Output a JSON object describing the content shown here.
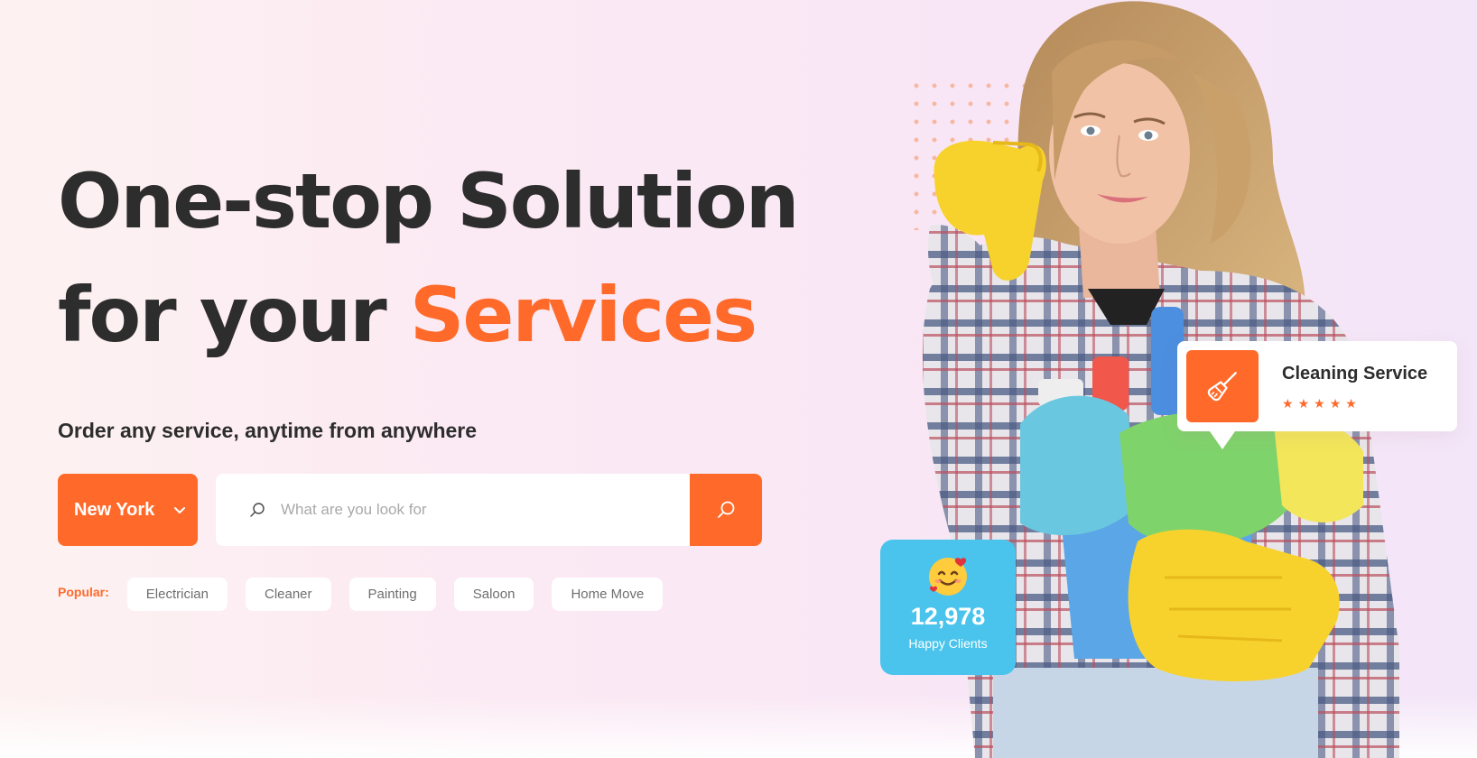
{
  "hero": {
    "headline_line1": "One-stop Solution",
    "headline_line2_prefix": "for your ",
    "headline_line2_accent": "Services",
    "subtitle": "Order any service, anytime from anywhere"
  },
  "search": {
    "city": "New York",
    "placeholder": "What are you look for",
    "value": ""
  },
  "popular": {
    "label": "Popular:",
    "tags": [
      "Electrician",
      "Cleaner",
      "Painting",
      "Saloon",
      "Home Move"
    ]
  },
  "stats_card": {
    "number": "12,978",
    "label": "Happy Clients",
    "icon": "smiling-face-with-hearts-icon"
  },
  "service_card": {
    "title": "Cleaning Service",
    "rating": 5,
    "icon": "broom-icon"
  },
  "colors": {
    "accent": "#ff6a2a",
    "text": "#2d2d2d",
    "stats_bg": "#4ac4ec"
  }
}
